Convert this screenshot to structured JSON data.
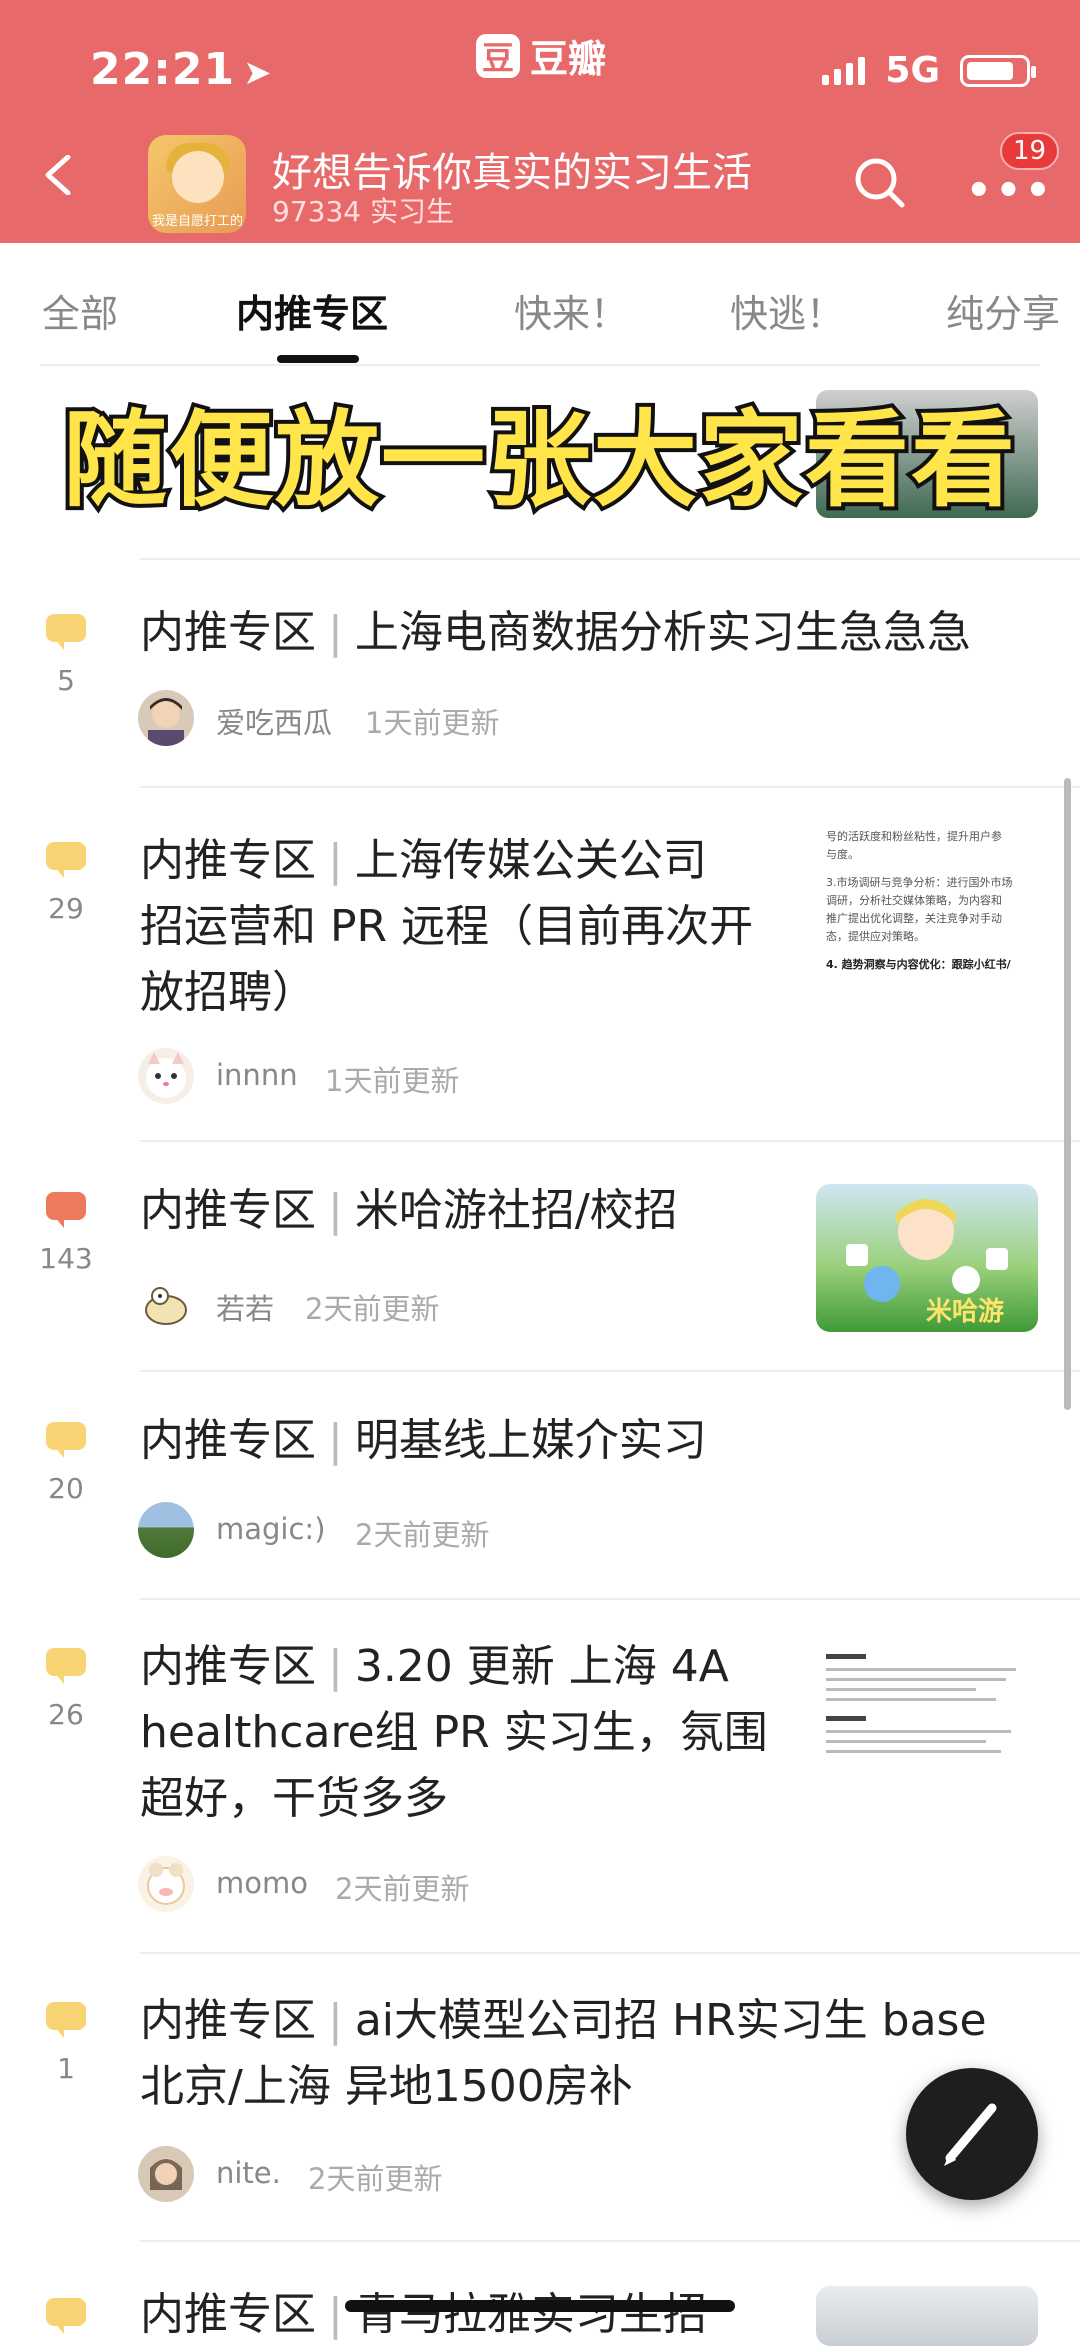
{
  "status": {
    "time": "22:21",
    "network": "5G"
  },
  "app": {
    "name": "豆瓣",
    "logo_char": "豆"
  },
  "group": {
    "title": "好想告诉你真实的实习生活",
    "members": "97334 实习生",
    "avatar_caption": "我是自愿打工的",
    "notifications": "19"
  },
  "tabs": [
    "全部",
    "内推专区",
    "快来！",
    "快逃！",
    "纯分享"
  ],
  "active_tab": "内推专区",
  "overlay_caption": "随便放一张大家看看",
  "colors": {
    "header": "#e8696a",
    "comment_normal": "#f8d474",
    "comment_hot": "#ee7a5c"
  },
  "posts": [
    {
      "tag": "内推专区",
      "title": "上海电商数据分析实习生急急急",
      "comments": "5",
      "author": "爱吃西瓜",
      "time": "1天前更新"
    },
    {
      "tag": "内推专区",
      "title_lines": [
        "上海传媒公关公司",
        "招运营和 PR 远程（目前再次开",
        "放招聘）"
      ],
      "comments": "29",
      "author": "innnn",
      "time": "1天前更新",
      "thumb_text": [
        "号的活跃度和粉丝粘性，提升用户参",
        "与度。",
        "3.市场调研与竞争分析：进行国外市场",
        "调研，分析社交媒体策略，为内容和",
        "推广提出优化调整，关注竞争对手动",
        "态，提供应对策略。",
        "4. 趋势洞察与内容优化：跟踪小红书/"
      ]
    },
    {
      "tag": "内推专区",
      "title": "米哈游社招/校招",
      "comments": "143",
      "author": "若若",
      "time": "2天前更新",
      "thumb_label": "米哈游"
    },
    {
      "tag": "内推专区",
      "title": "明基线上媒介实习",
      "comments": "20",
      "author": "magic:)",
      "time": "2天前更新"
    },
    {
      "tag": "内推专区",
      "title_lines": [
        "3.20 更新 上海 4A",
        "healthcare组 PR 实习生，氛围",
        "超好，干货多多"
      ],
      "comments": "26",
      "author": "momo",
      "time": "2天前更新"
    },
    {
      "tag": "内推专区",
      "title_lines": [
        "ai大模型公司招 HR实习生 base",
        "北京/上海 异地1500房补"
      ],
      "comments": "1",
      "author": "nite.",
      "time": "2天前更新"
    },
    {
      "tag": "内推专区",
      "title": "青马拉雅实习生招"
    }
  ]
}
